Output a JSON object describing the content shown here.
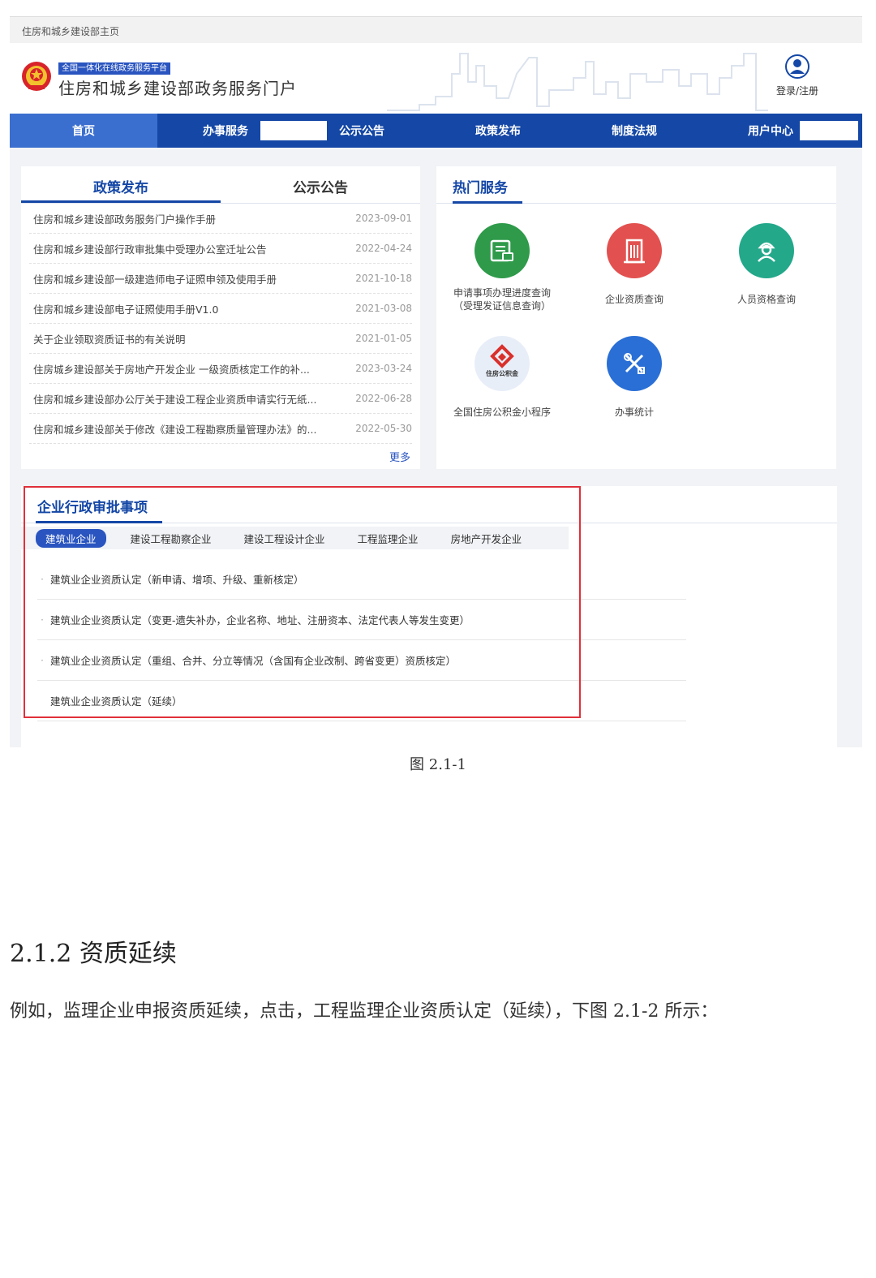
{
  "topbar": {
    "home_link": "住房和城乡建设部主页"
  },
  "header": {
    "badge": "全国一体化在线政务服务平台",
    "title": "住房和城乡建设部政务服务门户",
    "login": "登录/注册"
  },
  "nav": {
    "items": [
      "首页",
      "办事服务",
      "公示公告",
      "政策发布",
      "制度法规",
      "用户中心"
    ]
  },
  "policy_panel": {
    "tabs": [
      "政策发布",
      "公示公告"
    ],
    "news": [
      {
        "title": "住房和城乡建设部政务服务门户操作手册",
        "date": "2023-09-01"
      },
      {
        "title": "住房和城乡建设部行政审批集中受理办公室迁址公告",
        "date": "2022-04-24"
      },
      {
        "title": "住房和城乡建设部一级建造师电子证照申领及使用手册",
        "date": "2021-10-18"
      },
      {
        "title": "住房和城乡建设部电子证照使用手册V1.0",
        "date": "2021-03-08"
      },
      {
        "title": "关于企业领取资质证书的有关说明",
        "date": "2021-01-05"
      },
      {
        "title": "住房城乡建设部关于房地产开发企业 一级资质核定工作的补...",
        "date": "2023-03-24"
      },
      {
        "title": "住房和城乡建设部办公厅关于建设工程企业资质申请实行无纸...",
        "date": "2022-06-28"
      },
      {
        "title": "住房和城乡建设部关于修改《建设工程勘察质量管理办法》的...",
        "date": "2022-05-30"
      }
    ],
    "more": "更多"
  },
  "hot_services": {
    "title": "热门服务",
    "items": [
      {
        "label1": "申请事项办理进度查询",
        "label2": "（受理发证信息查询）",
        "color": "#2e9a4a",
        "icon": "document-progress-icon"
      },
      {
        "label1": "企业资质查询",
        "label2": "",
        "color": "#e2514f",
        "icon": "building-icon"
      },
      {
        "label1": "人员资格查询",
        "label2": "",
        "color": "#23a88a",
        "icon": "worker-icon"
      },
      {
        "label1": "全国住房公积金小程序",
        "label2": "",
        "color": "#d9302c",
        "icon": "housing-fund-logo-icon",
        "logo_text": "住房公积金"
      },
      {
        "label1": "办事统计",
        "label2": "",
        "color": "#2a6fd6",
        "icon": "tools-icon"
      }
    ]
  },
  "enterprise": {
    "title": "企业行政审批事项",
    "categories": [
      "建筑业企业",
      "建设工程勘察企业",
      "建设工程设计企业",
      "工程监理企业",
      "房地产开发企业"
    ],
    "items": [
      "建筑业企业资质认定（新申请、增项、升级、重新核定）",
      "建筑业企业资质认定（变更-遗失补办，企业名称、地址、注册资本、法定代表人等发生变更）",
      "建筑业企业资质认定（重组、合并、分立等情况（含国有企业改制、跨省变更）资质核定）",
      "建筑业企业资质认定（延续）"
    ]
  },
  "document": {
    "caption": "图 2.1-1",
    "section_title": "2.1.2 资质延续",
    "body": "例如，监理企业申报资质延续，点击，工程监理企业资质认定（延续），下图 2.1-2 所示："
  },
  "colors": {
    "nav_blue": "#1447a6",
    "accent_blue": "#2a55c0",
    "highlight_red": "#e0303a"
  }
}
